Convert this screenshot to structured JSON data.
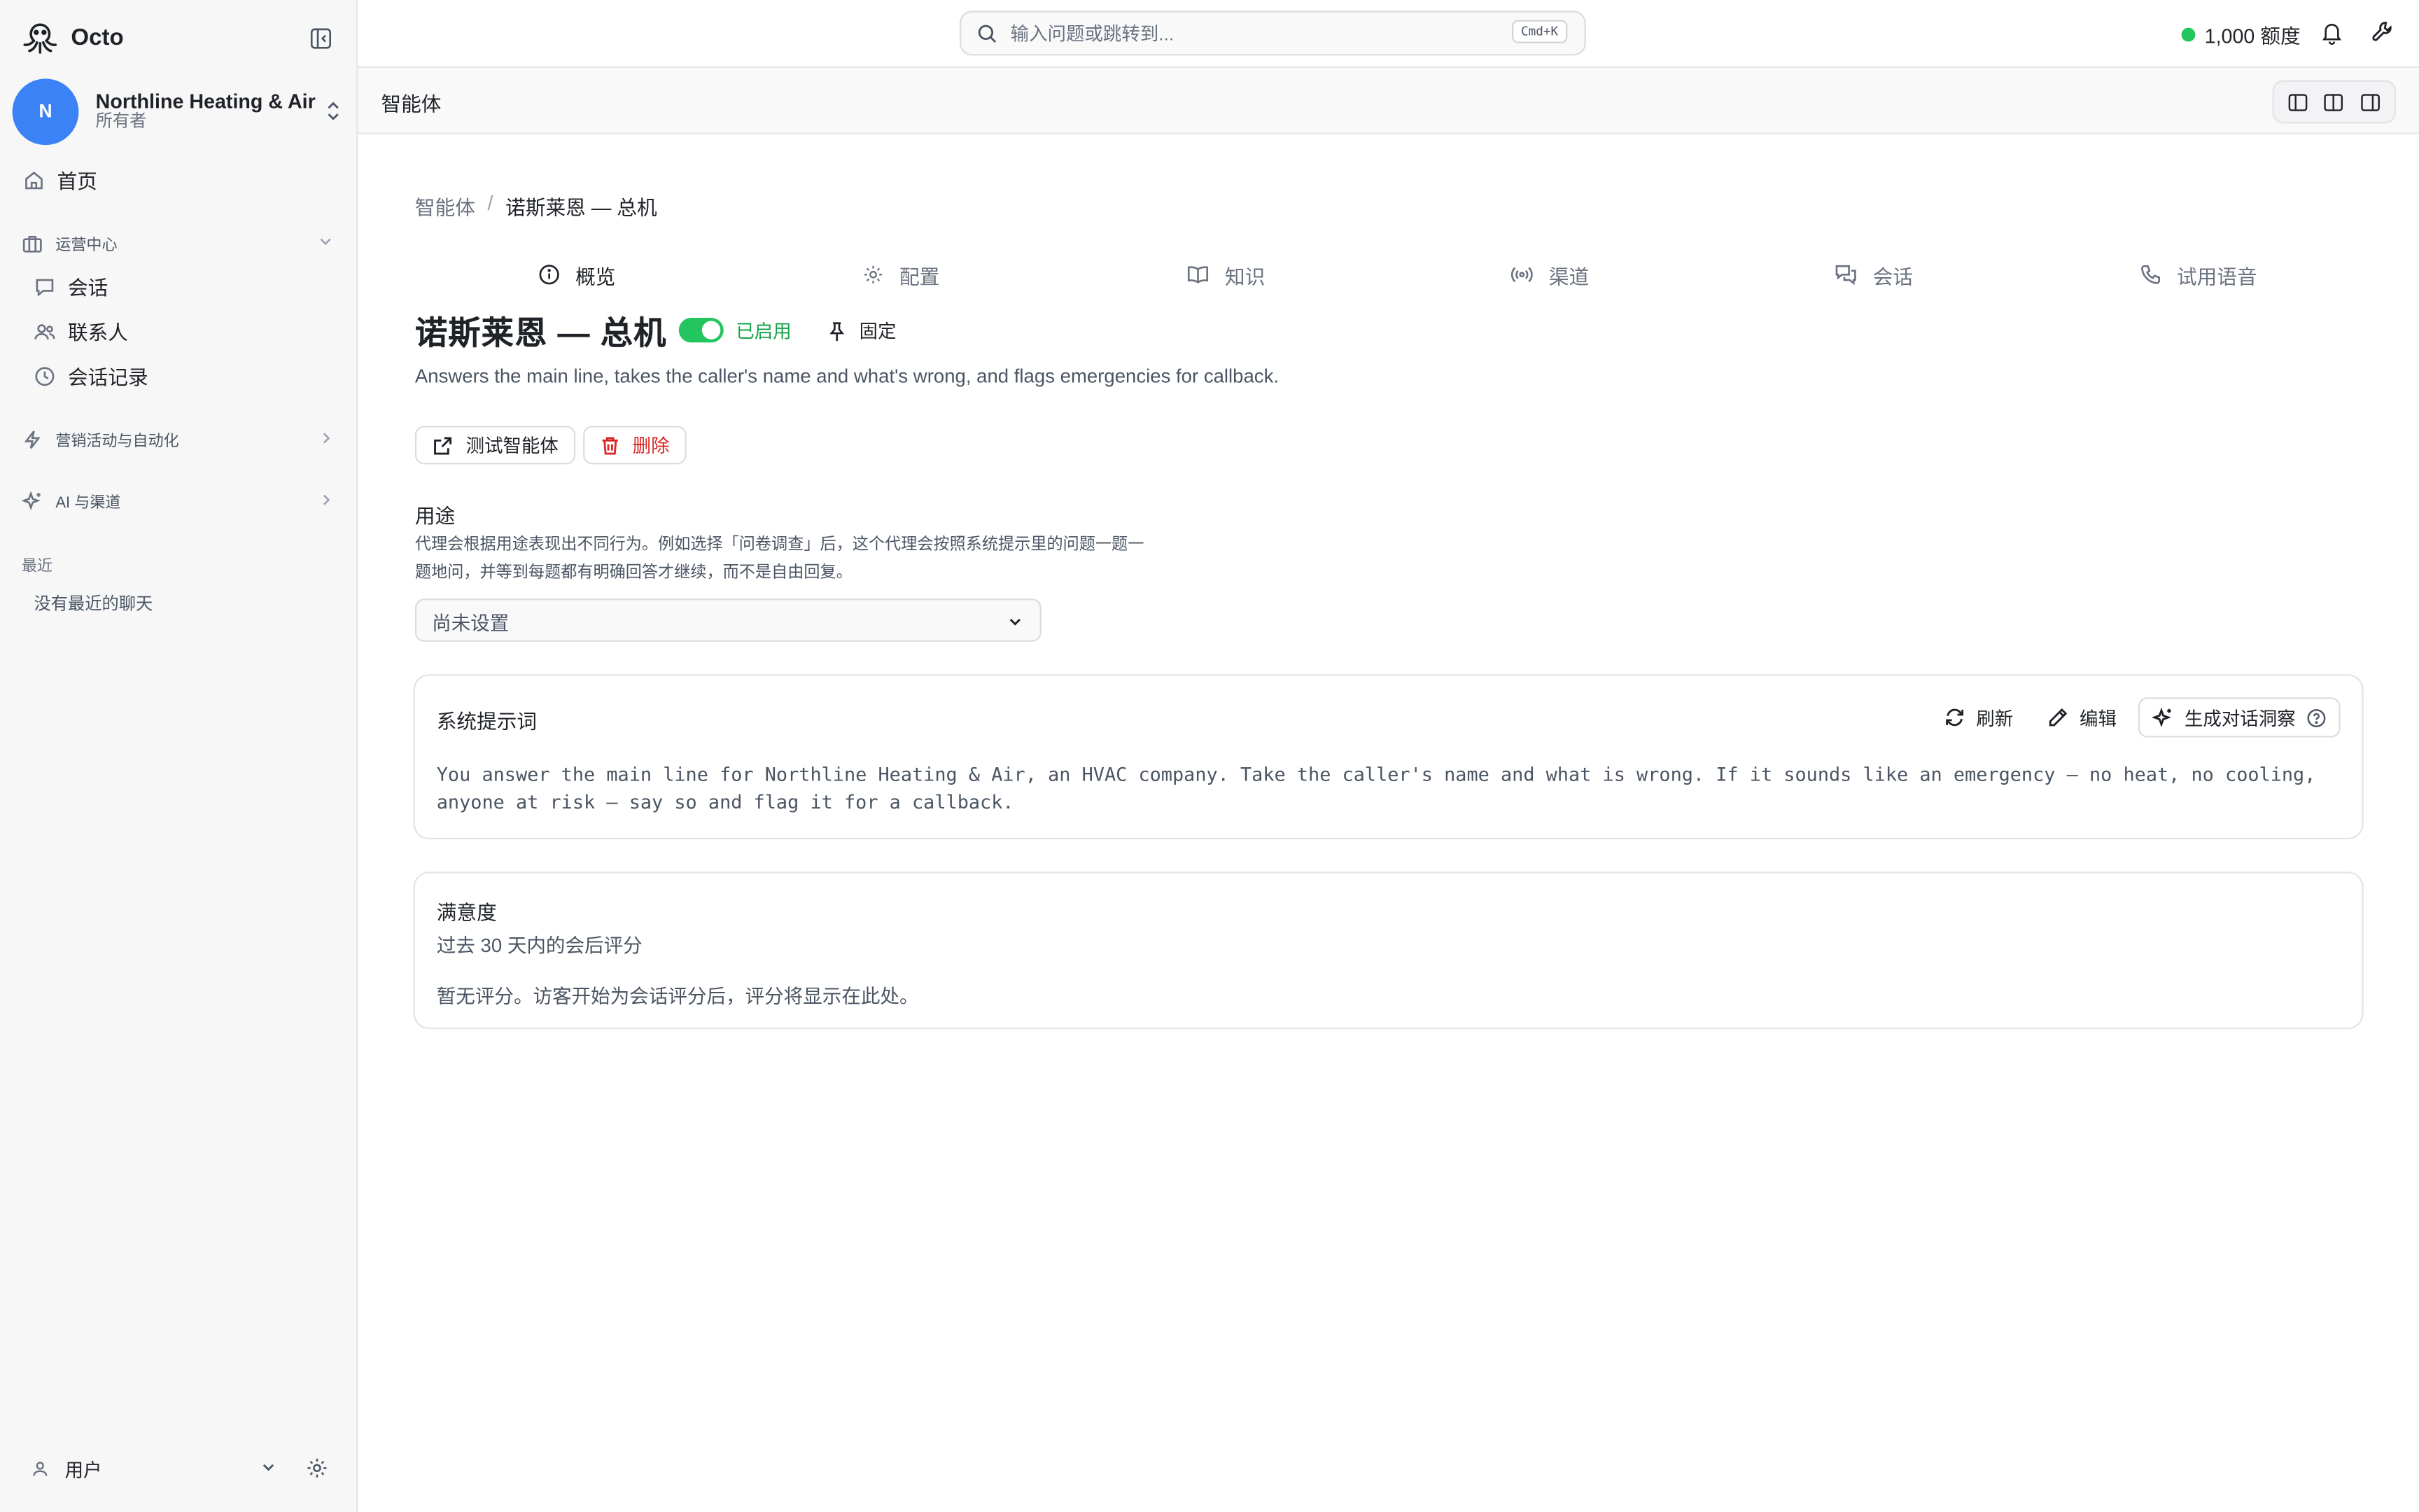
{
  "app": {
    "name": "Octo"
  },
  "org": {
    "initial": "N",
    "name": "Northline Heating & Air",
    "role": "所有者"
  },
  "sidebar": {
    "home": "首页",
    "ops_section": "运营中心",
    "ops_items": [
      {
        "label": "会话",
        "icon": "chat-icon"
      },
      {
        "label": "联系人",
        "icon": "users-icon"
      },
      {
        "label": "会话记录",
        "icon": "clock-icon"
      }
    ],
    "marketing_section": "营销活动与自动化",
    "ai_section": "AI 与渠道",
    "recent_title": "最近",
    "recent_empty": "没有最近的聊天",
    "user_label": "用户"
  },
  "topbar": {
    "search_placeholder": "输入问题或跳转到...",
    "search_shortcut": "Cmd+K",
    "credits": "1,000 额度",
    "credits_status_color": "#22c55e"
  },
  "pagebar": {
    "title": "智能体"
  },
  "breadcrumb": {
    "parent": "智能体",
    "separator": "/",
    "current": "诺斯莱恩 — 总机"
  },
  "tabs": [
    {
      "label": "概览",
      "icon": "info-icon",
      "active": true
    },
    {
      "label": "配置",
      "icon": "gear-icon",
      "active": false
    },
    {
      "label": "知识",
      "icon": "book-icon",
      "active": false
    },
    {
      "label": "渠道",
      "icon": "broadcast-icon",
      "active": false
    },
    {
      "label": "会话",
      "icon": "chats-icon",
      "active": false
    },
    {
      "label": "试用语音",
      "icon": "phone-icon",
      "active": false
    }
  ],
  "agent": {
    "title": "诺斯莱恩 — 总机",
    "enabled": true,
    "enabled_label": "已启用",
    "pin_label": "固定",
    "description": "Answers the main line, takes the caller's name and what's wrong, and flags emergencies for callback.",
    "test_button": "测试智能体",
    "delete_button": "删除"
  },
  "purpose": {
    "title": "用途",
    "help": "代理会根据用途表现出不同行为。例如选择「问卷调查」后，这个代理会按照系统提示里的问题一题一题地问，并等到每题都有明确回答才继续，而不是自由回复。",
    "selected": "尚未设置"
  },
  "system_prompt": {
    "title": "系统提示词",
    "refresh": "刷新",
    "edit": "编辑",
    "insights": "生成对话洞察",
    "text": "You answer the main line for Northline Heating & Air, an HVAC company. Take the caller's name and what is wrong. If it sounds like an emergency — no heat, no cooling, anyone at risk — say so and flag it for a callback."
  },
  "satisfaction": {
    "title": "满意度",
    "subtitle": "过去 30 天内的会后评分",
    "empty": "暂无评分。访客开始为会话评分后，评分将显示在此处。"
  },
  "colors": {
    "accent": "#3b82f6",
    "success": "#22c55e",
    "danger": "#dc2626"
  }
}
